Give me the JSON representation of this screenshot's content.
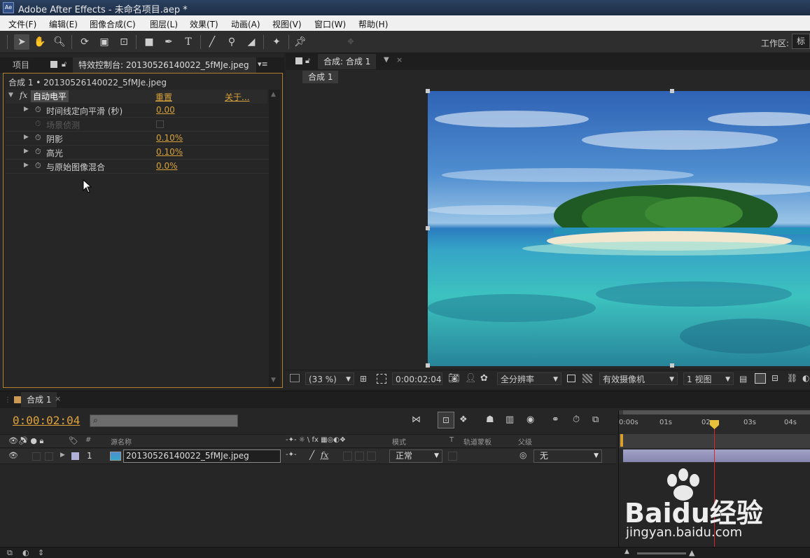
{
  "window": {
    "title": "Adobe After Effects - 未命名项目.aep *",
    "app_icon": "Ae"
  },
  "menu": [
    "文件(F)",
    "编辑(E)",
    "图像合成(C)",
    "图层(L)",
    "效果(T)",
    "动画(A)",
    "视图(V)",
    "窗口(W)",
    "帮助(H)"
  ],
  "toolbar": {
    "workspace_label": "工作区:",
    "workspace_value": "标"
  },
  "left_panel": {
    "tab_project": "项目",
    "tab_effects": "特效控制台: 20130526140022_5fMJe.jpeg",
    "breadcrumb": "合成 1 • 20130526140022_5fMJe.jpeg",
    "effect": {
      "fx": "fx",
      "name": "自动电平",
      "reset": "重置",
      "about": "关于..."
    },
    "properties": [
      {
        "label": "时间线定向平滑 (秒)",
        "value": "0.00",
        "disabled": false,
        "has_arrow": true
      },
      {
        "label": "场景侦测",
        "value": "",
        "disabled": true,
        "has_arrow": false
      },
      {
        "label": "阴影",
        "value": "0.10%",
        "disabled": false,
        "has_arrow": true
      },
      {
        "label": "高光",
        "value": "0.10%",
        "disabled": false,
        "has_arrow": true
      },
      {
        "label": "与原始图像混合",
        "value": "0.0%",
        "disabled": false,
        "has_arrow": true
      }
    ]
  },
  "comp_panel": {
    "tab": "合成: 合成 1",
    "subtab": "合成 1",
    "bottom": {
      "zoom": "(33 %)",
      "timecode": "0:00:02:04",
      "resolution": "全分辨率",
      "camera": "有效摄像机",
      "views": "1 视图"
    }
  },
  "timeline": {
    "tab": "合成 1",
    "timecode": "0:00:02:04",
    "columns": {
      "source_name": "源名称",
      "mode": "模式",
      "t": "T",
      "trkmat": "轨道蒙板",
      "parent": "父级",
      "num": "#"
    },
    "layer": {
      "index": "1",
      "name": "20130526140022_5fMJe.jpeg",
      "mode": "正常",
      "parent": "无"
    },
    "ruler": [
      "0:00s",
      "01s",
      "02s",
      "03s",
      "04s"
    ]
  },
  "watermark": {
    "brand": "Baidu经验",
    "url": "jingyan.baidu.com"
  }
}
